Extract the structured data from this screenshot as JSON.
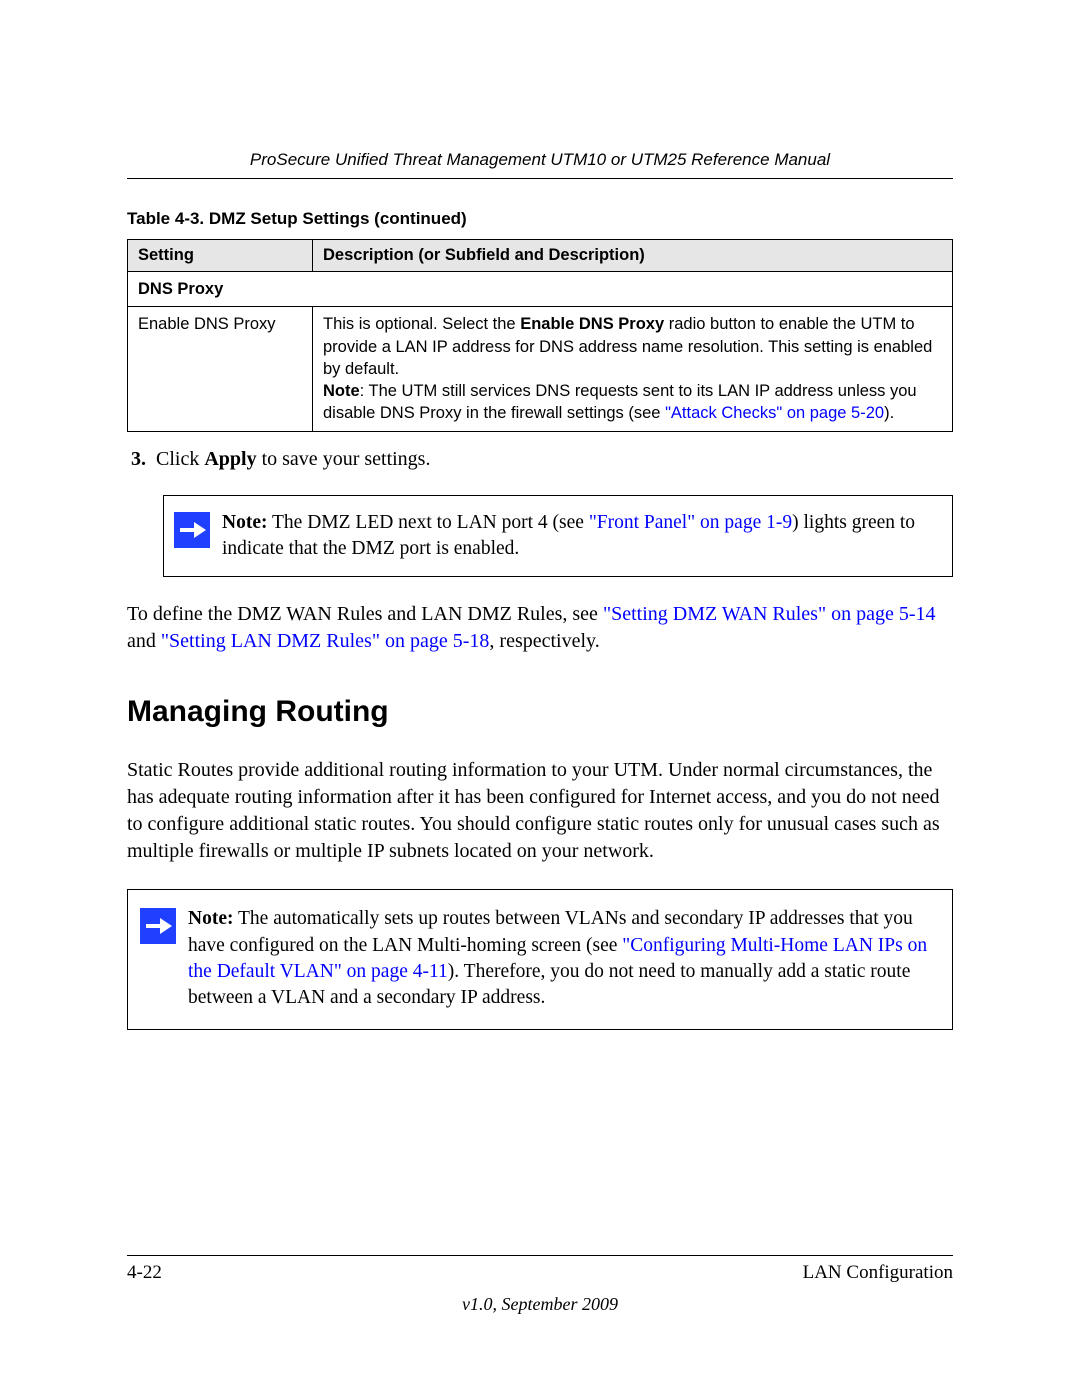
{
  "header": {
    "running_title": "ProSecure Unified Threat Management UTM10 or UTM25 Reference Manual"
  },
  "table": {
    "caption": "Table 4-3. DMZ Setup Settings (continued)",
    "columns": {
      "setting": "Setting",
      "description": "Description (or Subfield and Description)"
    },
    "section_header": "DNS Proxy",
    "row": {
      "setting": "Enable DNS Proxy",
      "desc_part1": "This is optional. Select the ",
      "desc_bold": "Enable DNS Proxy",
      "desc_part2": " radio button to enable the UTM to provide a LAN IP address for DNS address name resolution. This setting is enabled by default.",
      "note_label": "Note",
      "note_text": ": The UTM still services DNS requests sent to its LAN IP address unless you disable DNS Proxy in the firewall settings (see ",
      "note_link": "\"Attack Checks\" on page 5-20",
      "note_after": ")."
    }
  },
  "step3": {
    "num": "3.",
    "pre": "Click ",
    "bold": "Apply",
    "post": " to save your settings."
  },
  "note1": {
    "label": "Note:",
    "pre": " The DMZ LED next to LAN port 4 (see ",
    "link": "\"Front Panel\" on page 1-9",
    "post": ") lights green to indicate that the DMZ port is enabled."
  },
  "dmz_rules": {
    "pre": "To define the DMZ WAN Rules and LAN DMZ Rules, see ",
    "link1": "\"Setting DMZ WAN Rules\" on page 5-14",
    "mid": " and ",
    "link2": "\"Setting LAN DMZ Rules\" on page 5-18",
    "post": ", respectively."
  },
  "heading": "Managing Routing",
  "routing_para": "Static Routes provide additional routing information to your UTM. Under normal circumstances, the  has adequate routing information after it has been configured for Internet access, and you do not need to configure additional static routes. You should configure static routes only for unusual cases such as multiple firewalls or multiple IP subnets located on your network.",
  "note2": {
    "label": "Note:",
    "pre": " The  automatically sets up routes between VLANs and secondary IP addresses that you have configured on the LAN Multi-homing screen (see ",
    "link": "\"Configuring Multi-Home LAN IPs on the Default VLAN\" on page 4-11",
    "post": "). Therefore, you do not need to manually add a static route between a VLAN and a secondary IP address."
  },
  "footer": {
    "page_num": "4-22",
    "section": "LAN Configuration",
    "version": "v1.0, September 2009"
  }
}
